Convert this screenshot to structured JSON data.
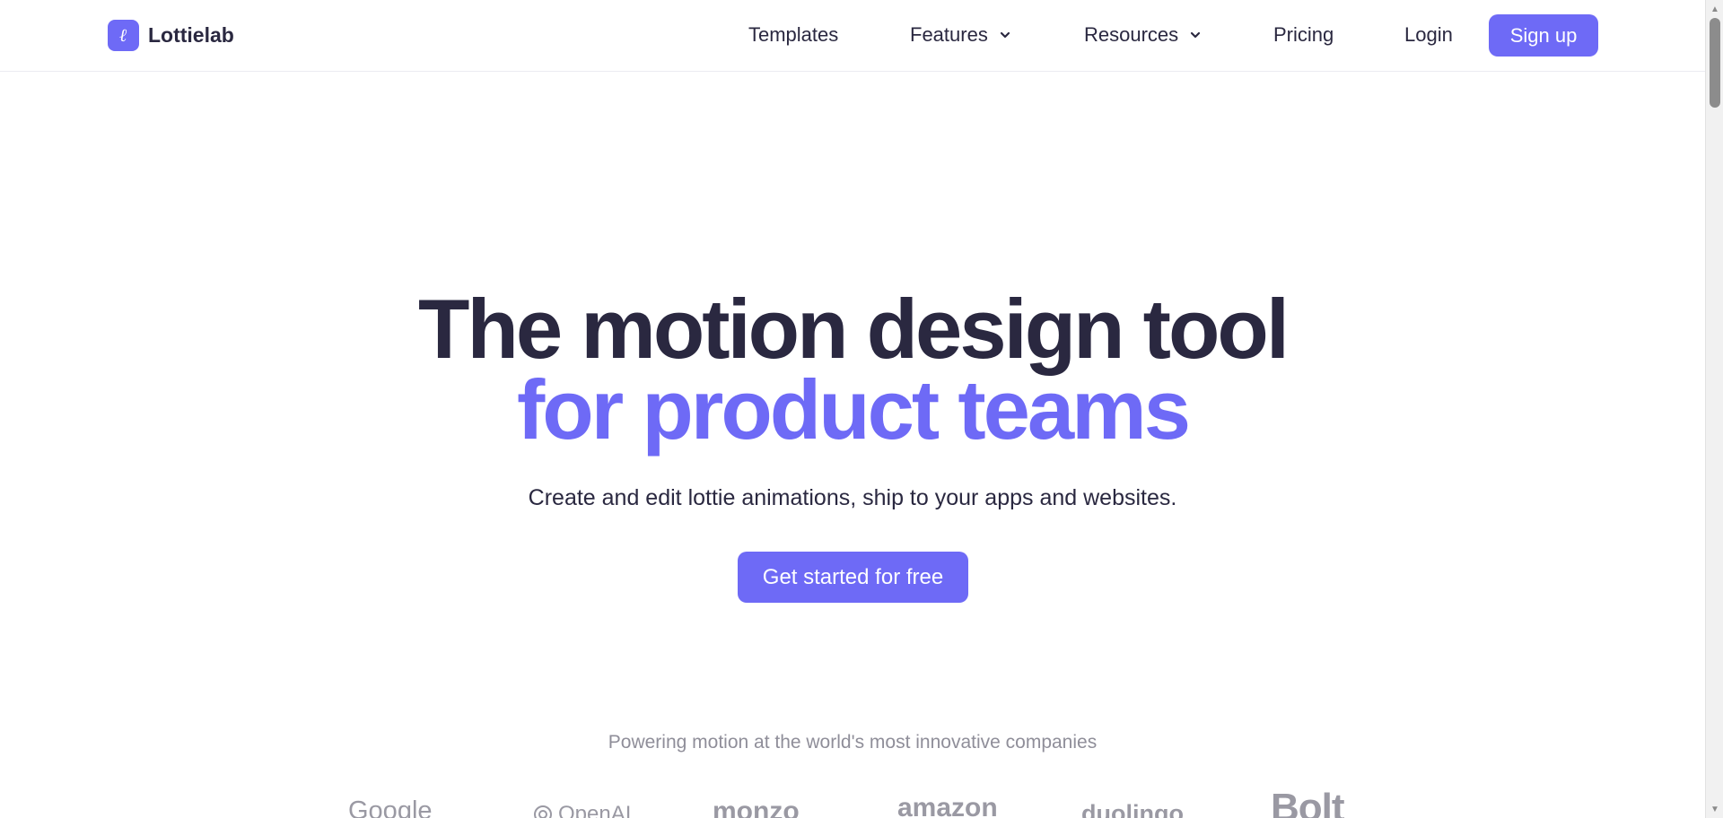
{
  "brand": {
    "name": "Lottielab",
    "mark": "ℓ",
    "accent_color": "#6e6af6",
    "text_color": "#2a2840"
  },
  "nav": {
    "items": [
      {
        "label": "Templates",
        "has_dropdown": false
      },
      {
        "label": "Features",
        "has_dropdown": true
      },
      {
        "label": "Resources",
        "has_dropdown": true
      },
      {
        "label": "Pricing",
        "has_dropdown": false
      },
      {
        "label": "Login",
        "has_dropdown": false
      }
    ],
    "signup_label": "Sign up"
  },
  "hero": {
    "title_line1": "The motion design tool",
    "title_line2": "for product teams",
    "subtitle": "Create and edit lottie animations, ship to your apps and websites.",
    "cta_label": "Get started for free"
  },
  "social_proof": {
    "heading": "Powering motion at the world's most innovative companies",
    "companies": [
      "Google",
      "OpenAI",
      "monzo",
      "amazon",
      "duolingo",
      "Bolt"
    ]
  },
  "icons": {
    "chevron": "chevron-down-icon",
    "openai": "openai-logo-icon",
    "scroll_up": "scroll-up-arrow-icon",
    "scroll_down": "scroll-down-arrow-icon"
  }
}
